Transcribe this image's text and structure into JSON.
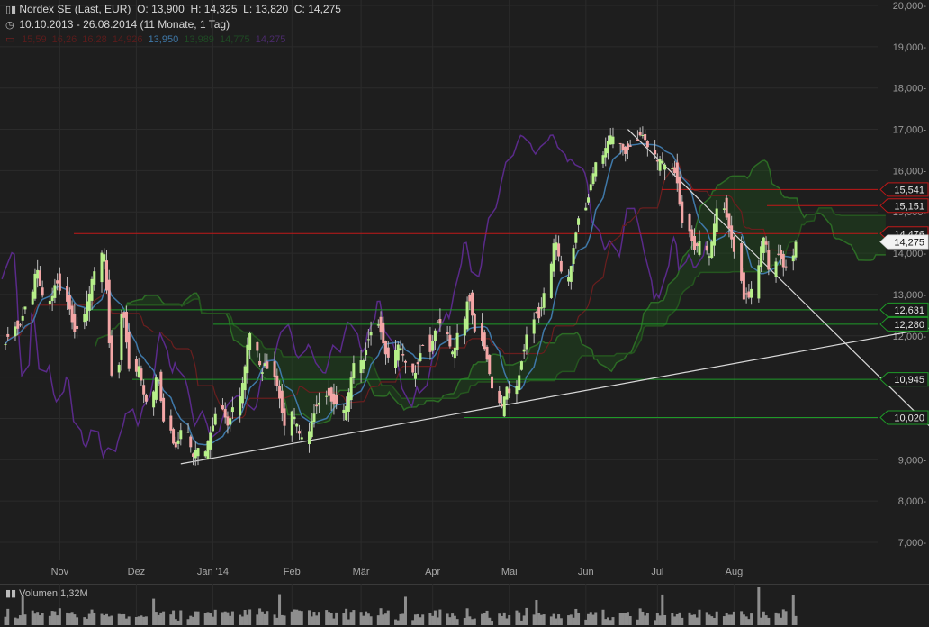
{
  "header": {
    "title": "Nordex SE (Last, EUR)",
    "open": "O: 13,900",
    "high": "H: 14,325",
    "low": "L: 13,820",
    "close": "C: 14,275",
    "range": "10.10.2013 - 26.08.2014 (11 Monate, 1 Tag)",
    "indicator_values": [
      "15,59",
      "16,26",
      "16,28",
      "14,926",
      "13,950",
      "13,989",
      "14,775",
      "14,275"
    ]
  },
  "volume_label": "Volumen 1,32M",
  "colors": {
    "background": "#1e1e1e",
    "up_candle": "#b7f08a",
    "down_candle": "#f3a6a6",
    "resistance": "#c01818",
    "support": "#1f9a28",
    "trendline": "#d8d8d8",
    "kijun": "#3f78a8",
    "chikou": "#5a2a8a",
    "cloud_line": "#2c6b25"
  },
  "chart_data": {
    "type": "candlestick",
    "title": "Nordex SE (Last, EUR)",
    "ylim": [
      6500,
      20300
    ],
    "y_ticks": [
      7000,
      8000,
      9000,
      10000,
      11000,
      12000,
      13000,
      14000,
      15000,
      16000,
      17000,
      18000,
      19000,
      20000
    ],
    "y_tick_labels": [
      "7,000-",
      "8,000-",
      "9,000-",
      "10,000-",
      "11,000-",
      "12,000-",
      "13,000-",
      "14,000-",
      "15,000-",
      "16,000-",
      "17,000-",
      "18,000-",
      "19,000-",
      "20,000-"
    ],
    "x_labels": [
      "Nov",
      "Dez",
      "Jan '14",
      "Feb",
      "Mär",
      "Apr",
      "Mai",
      "Jun",
      "Jul",
      "Aug"
    ],
    "x_label_dates": [
      "2013-11-01",
      "2013-12-02",
      "2014-01-02",
      "2014-02-03",
      "2014-03-03",
      "2014-04-01",
      "2014-05-02",
      "2014-06-02",
      "2014-07-01",
      "2014-08-01"
    ],
    "closes": [
      11.8,
      12.0,
      12.3,
      12.1,
      12.4,
      12.6,
      13.0,
      13.5,
      13.6,
      13.1,
      12.9,
      12.8,
      13.2,
      13.3,
      13.1,
      12.8,
      12.6,
      12.2,
      12.0,
      12.4,
      12.8,
      13.0,
      13.4,
      13.6,
      14.2,
      13.8,
      12.2,
      11.0,
      11.2,
      12.6,
      12.4,
      11.6,
      10.9,
      11.4,
      11.0,
      10.6,
      10.4,
      10.7,
      11.1,
      10.8,
      10.0,
      9.8,
      9.4,
      9.3,
      9.5,
      9.8,
      9.6,
      9.0,
      9.2,
      9.3,
      9.2,
      9.5,
      9.7,
      9.9,
      10.3,
      10.1,
      9.8,
      10.0,
      10.3,
      10.6,
      11.0,
      11.5,
      12.2,
      11.7,
      11.3,
      11.1,
      11.4,
      11.1,
      10.9,
      10.6,
      10.2,
      9.8,
      10.2,
      10.0,
      9.8,
      9.5,
      9.6,
      9.9,
      10.1,
      10.3,
      10.4,
      10.6,
      10.5,
      10.3,
      10.4,
      10.2,
      10.3,
      10.7,
      11.1,
      11.5,
      11.3,
      11.6,
      11.9,
      12.1,
      12.3,
      12.0,
      11.7,
      11.4,
      11.6,
      11.8,
      11.7,
      11.5,
      11.3,
      11.0,
      11.2,
      11.5,
      11.8,
      11.6,
      11.9,
      12.2,
      12.4,
      12.2,
      11.8,
      11.6,
      11.7,
      12.1,
      12.5,
      13.0,
      12.7,
      12.2,
      11.9,
      11.7,
      11.4,
      11.0,
      10.6,
      10.2,
      10.4,
      10.8,
      10.6,
      10.8,
      11.1,
      11.5,
      11.8,
      12.3,
      12.6,
      12.4,
      12.7,
      13.1,
      14.0,
      14.4,
      14.1,
      13.6,
      13.4,
      13.7,
      14.2,
      14.6,
      15.0,
      15.2,
      15.6,
      15.9,
      16.2,
      16.4,
      16.6,
      16.8,
      16.9,
      16.7,
      16.5,
      16.4,
      16.5,
      16.6,
      16.8,
      16.9,
      16.8,
      16.6,
      16.4,
      16.2,
      16.3,
      16.2,
      16.1,
      16.0,
      15.8,
      15.2,
      14.7,
      14.5,
      14.2,
      14.0,
      14.4,
      14.1,
      13.9,
      14.3,
      14.8,
      15.2,
      15.0,
      14.7,
      14.4,
      14.1,
      13.3,
      12.8,
      13.1,
      12.8,
      13.5,
      14.1,
      14.4,
      14.2,
      13.5,
      13.9,
      14.0,
      13.7,
      13.6,
      13.9,
      14.275
    ],
    "ichimoku": {
      "tenkan": "light blue",
      "kijun": "steel blue",
      "chikou": "purple",
      "cloud": "green shaded"
    },
    "horizontal_levels": [
      {
        "value": "15,541",
        "kind": "resistance"
      },
      {
        "value": "15,151",
        "kind": "resistance"
      },
      {
        "value": "14,476",
        "kind": "resistance"
      },
      {
        "value": "14,275",
        "kind": "last"
      },
      {
        "value": "12,631",
        "kind": "support"
      },
      {
        "value": "12,280",
        "kind": "support"
      },
      {
        "value": "10,945",
        "kind": "support"
      },
      {
        "value": "10,020",
        "kind": "support"
      }
    ],
    "trendlines": [
      {
        "name": "ascending support",
        "from": [
          "2013-12-20",
          8.9
        ],
        "to": [
          "2014-08-26",
          11.6
        ]
      },
      {
        "name": "descending resistance",
        "from": [
          "2014-06-19",
          17.0
        ],
        "to": [
          "2014-08-26",
          13.0
        ]
      }
    ],
    "volume": {
      "label": "Volumen 1,32M",
      "unit": "shares",
      "last": 1.32
    }
  }
}
